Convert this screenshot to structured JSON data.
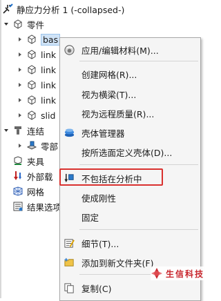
{
  "tree": {
    "root": "静应力分析 1 (-collapsed-)",
    "parts_label": "零件",
    "items": [
      "bas",
      "link",
      "link",
      "link",
      "link",
      "slid"
    ],
    "connections_label": "连结",
    "sub_connection_label": "零部",
    "fixtures_label": "夹具",
    "external_loads_label": "外部载",
    "mesh_label": "网格",
    "results_label": "结果选项"
  },
  "context_menu": {
    "items": [
      {
        "label": "应用/编辑材料(M)...",
        "icon": "material-icon"
      },
      {
        "label": "创建网格(R)...",
        "icon": ""
      },
      {
        "label": "视为横梁(T)...",
        "icon": ""
      },
      {
        "label": "视为远程质量(R)...",
        "icon": ""
      },
      {
        "label": "壳体管理器",
        "icon": "shell-manager-icon"
      },
      {
        "label": "按所选面定义壳体(D)...",
        "icon": ""
      },
      {
        "label": "不包括在分析中",
        "icon": "exclude-icon"
      },
      {
        "label": "使成刚性",
        "icon": ""
      },
      {
        "label": "固定",
        "icon": ""
      },
      {
        "label": "细节(T)...",
        "icon": "details-icon"
      },
      {
        "label": "添加到新文件夹(F)",
        "icon": "add-folder-icon"
      },
      {
        "label": "复制(C)",
        "icon": "copy-icon"
      }
    ],
    "highlight_color": "#d9302e"
  },
  "watermark": {
    "text": "生信科技",
    "color": "#c8252c"
  }
}
